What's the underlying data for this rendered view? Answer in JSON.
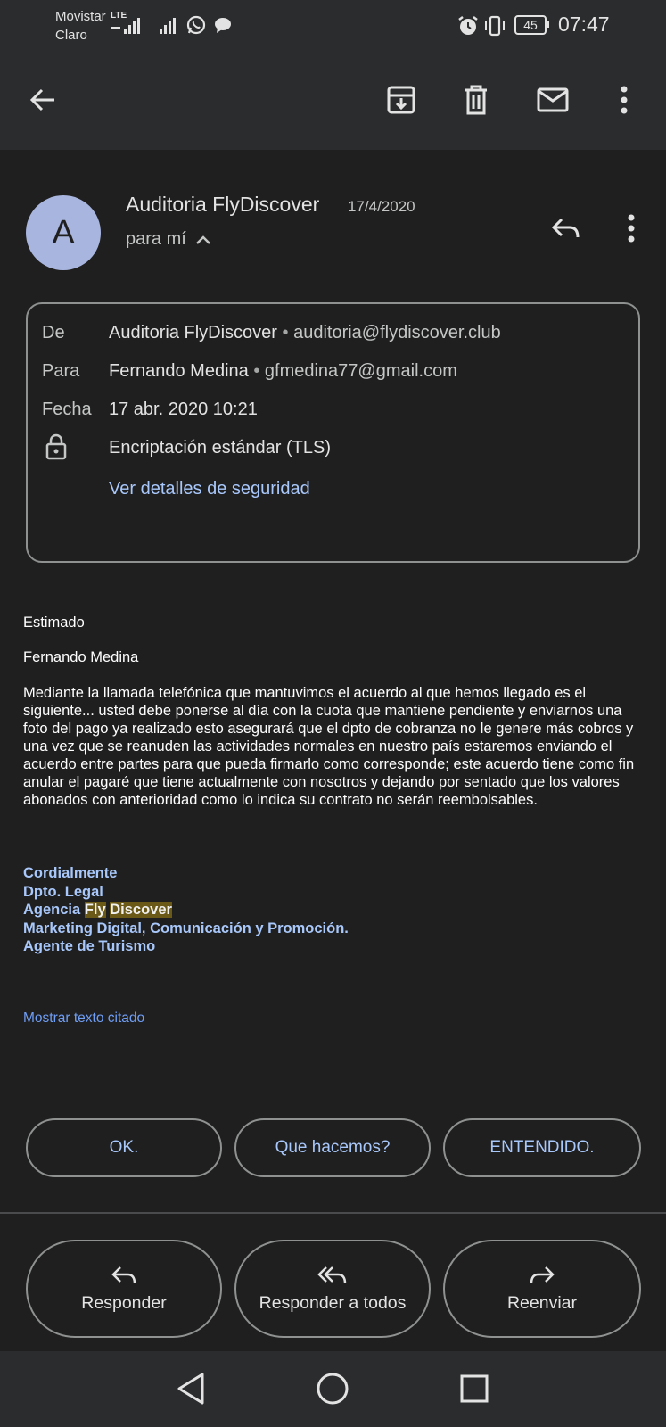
{
  "status_bar": {
    "carrier_1": "Movistar",
    "carrier_2": "Claro",
    "network_type": "LTE",
    "battery": "45",
    "time": "07:47"
  },
  "app_bar": {
    "back_icon": "arrow-left-icon",
    "actions": [
      "archive-icon",
      "delete-icon",
      "mark-unread-icon",
      "more-vert-icon"
    ]
  },
  "email": {
    "avatar_letter": "A",
    "sender": "Auditoria FlyDiscover",
    "date": "17/4/2020",
    "recipient_summary": "para mí",
    "details": {
      "from_label": "De",
      "from_name": "Auditoria FlyDiscover",
      "from_email": "auditoria@flydiscover.club",
      "to_label": "Para",
      "to_name": "Fernando Medina",
      "to_email": "gfmedina77@gmail.com",
      "date_label": "Fecha",
      "date_value": "17 abr. 2020 10:21",
      "encryption": "Encriptación estándar (TLS)",
      "security_link": "Ver detalles de seguridad"
    },
    "body": {
      "greeting": "Estimado",
      "name": "Fernando Medina",
      "paragraph": "Mediante la llamada telefónica que mantuvimos  el acuerdo al que hemos llegado es el siguiente... usted debe ponerse al día con la cuota que mantiene pendiente y enviarnos una foto del pago ya realizado esto asegurará que el dpto de cobranza no le genere más cobros y una vez que se reanuden las actividades normales en nuestro país estaremos enviando el acuerdo entre partes para que pueda firmarlo como corresponde; este acuerdo tiene como fin anular el pagaré que tiene actualmente con nosotros y dejando por sentado que los valores abonados con anterioridad como lo indica su contrato no serán reembolsables.",
      "signature": {
        "line1": "Cordialmente",
        "line2": "Dpto. Legal",
        "line3_prefix": "Agencia ",
        "line3_hl1": "Fly",
        "line3_hl2": "Discover",
        "line4": "Marketing Digital, Comunicación y Promoción.",
        "line5": "Agente de Turismo"
      }
    },
    "show_quoted": "Mostrar texto citado"
  },
  "smart_replies": [
    "OK.",
    "Que hacemos?",
    "ENTENDIDO."
  ],
  "actions": {
    "reply": "Responder",
    "reply_all": "Responder a todos",
    "forward": "Reenviar"
  },
  "nav_bar": [
    "back-triangle-icon",
    "home-circle-icon",
    "recents-square-icon"
  ]
}
